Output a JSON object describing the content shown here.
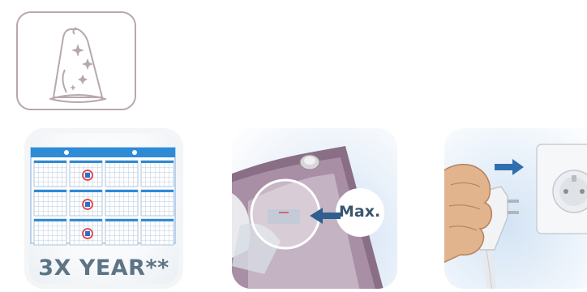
{
  "frequency_caption": "3X YEAR**",
  "max_label": "Max.",
  "colors": {
    "icon_stroke": "#b7a8ab",
    "iron_purple": "#8a6e86",
    "water_blue": "#2f5f8f",
    "calendar_blue": "#2e8bd6",
    "mark_red": "#e0414c",
    "caption_gray": "#5d7486"
  },
  "icons": {
    "header": "iron-sparkle-icon",
    "calendar": "calendar-icon",
    "fill": "iron-max-fill-icon",
    "unplug": "unplug-icon"
  },
  "calendar_marks": 3
}
